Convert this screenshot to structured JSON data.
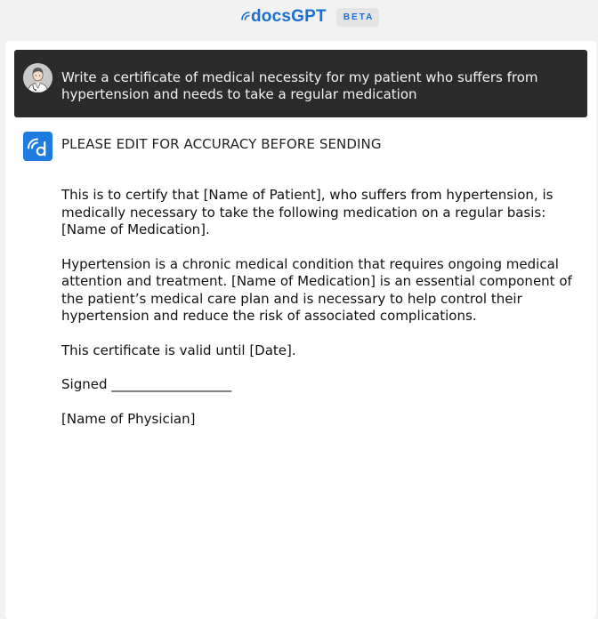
{
  "header": {
    "brand": "docsGPT",
    "badge": "BETA"
  },
  "conversation": {
    "user_message": "Write a certificate of medical necessity for my patient who suffers from hypertension and needs to take a regular medication",
    "assistant_warning": "PLEASE EDIT FOR ACCURACY BEFORE SENDING",
    "assistant_paragraphs": [
      "This is to certify that [Name of Patient], who suffers from hypertension, is medically necessary to take the following medication on a regular basis: [Name of Medication].",
      "Hypertension is a chronic medical condition that requires ongoing medical attention and treatment. [Name of Medication] is an essential component of the patient’s medical care plan and is necessary to help control their hypertension and reduce the risk of associated complications.",
      "This certificate is valid until [Date].",
      "Signed __________________",
      "[Name of Physician]"
    ]
  },
  "icons": {
    "brand_logo": "docsgpt-logo-icon",
    "user_avatar": "doctor-avatar-icon",
    "assistant_avatar": "docsgpt-d-icon"
  },
  "colors": {
    "brand_blue": "#1a6fd4",
    "user_bubble": "#2b2b2b",
    "assistant_icon_bg": "#1e7be0"
  }
}
